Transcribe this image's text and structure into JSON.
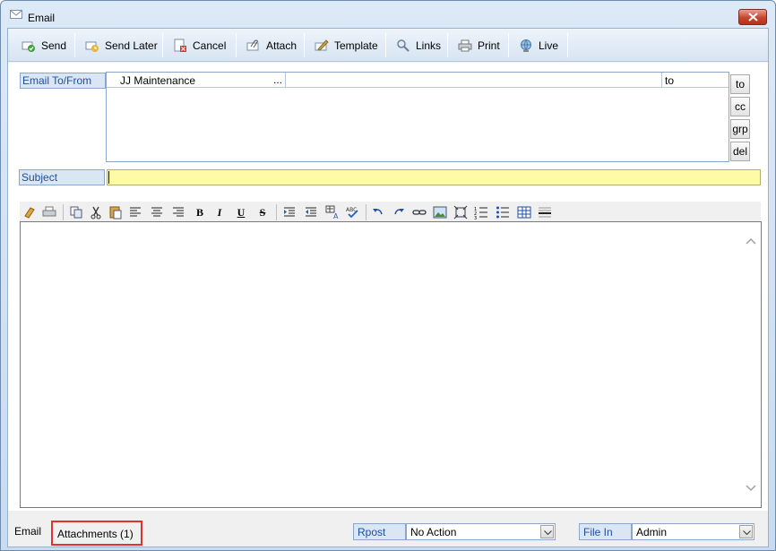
{
  "window": {
    "title": "Email"
  },
  "toolbar": {
    "buttons": [
      {
        "label": "Send",
        "icon": "send-icon"
      },
      {
        "label": "Send Later",
        "icon": "send-later-icon"
      },
      {
        "label": "Cancel",
        "icon": "cancel-icon"
      },
      {
        "label": "Attach",
        "icon": "attach-icon"
      },
      {
        "label": "Template",
        "icon": "template-icon"
      },
      {
        "label": "Links",
        "icon": "links-icon"
      },
      {
        "label": "Print",
        "icon": "print-icon"
      },
      {
        "label": "Live",
        "icon": "globe-icon"
      }
    ]
  },
  "recipients": {
    "label": "Email To/From",
    "rows": [
      {
        "name": "JJ Maintenance",
        "dots": "...",
        "type": "to"
      }
    ],
    "side_buttons": [
      "to",
      "cc",
      "grp",
      "del"
    ]
  },
  "subject": {
    "label": "Subject",
    "value": ""
  },
  "editor_toolbar": {
    "bold": "B",
    "italic": "I",
    "underline": "U",
    "strike": "S"
  },
  "bottom": {
    "tab_email": "Email",
    "tab_attachments": "Attachments (1)",
    "rpost_label": "Rpost",
    "rpost_value": "No Action",
    "filein_label": "File In",
    "filein_value": "Admin"
  },
  "colors": {
    "highlight": "#e0322f",
    "subject_bg": "#fffaa5",
    "label_text": "#1d4f9c"
  }
}
